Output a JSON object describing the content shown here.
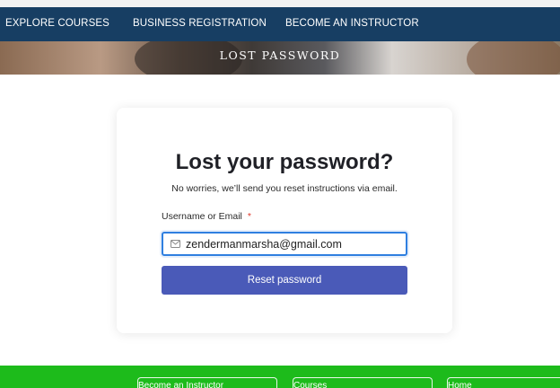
{
  "nav": {
    "items": [
      {
        "label": "EXPLORE COURSES"
      },
      {
        "label": "BUSINESS REGISTRATION"
      },
      {
        "label": "BECOME AN INSTRUCTOR"
      }
    ]
  },
  "hero": {
    "title": "LOST PASSWORD"
  },
  "card": {
    "title": "Lost your password?",
    "subtitle": "No worries, we’ll send you reset instructions via email.",
    "field_label": "Username or Email",
    "required_mark": "*",
    "input_value": "zendermanmarsha@gmail.com",
    "input_icon": "mail-icon",
    "button_label": "Reset password"
  },
  "footer": {
    "links": [
      {
        "label": "Become an Instructor"
      },
      {
        "label": "Courses"
      },
      {
        "label": "Home"
      }
    ]
  },
  "colors": {
    "nav_bg": "#173e63",
    "button_bg": "#4a5ab8",
    "input_focus": "#2f7fe0",
    "footer_bg": "#1dbb1b",
    "required": "#e0392c"
  }
}
